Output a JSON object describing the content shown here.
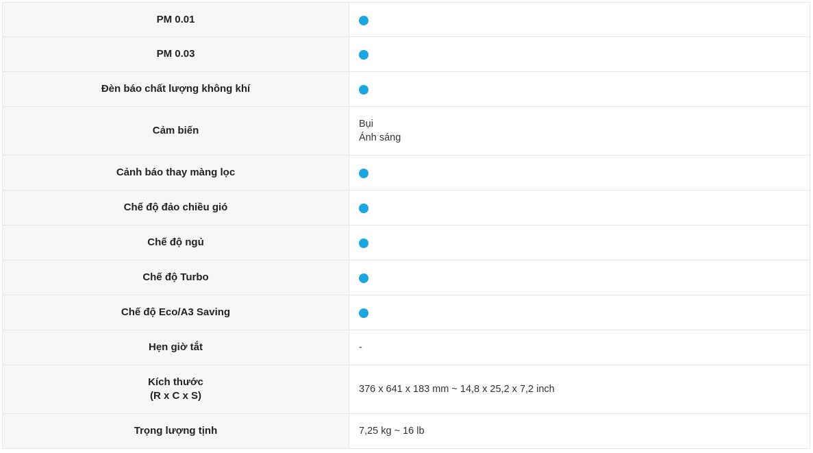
{
  "rows": [
    {
      "label": [
        "PM 0.01"
      ],
      "type": "dot"
    },
    {
      "label": [
        "PM 0.03"
      ],
      "type": "dot"
    },
    {
      "label": [
        "Đèn báo chất lượng không khí"
      ],
      "type": "dot"
    },
    {
      "label": [
        "Cảm biến"
      ],
      "type": "text",
      "value": [
        "Bụi",
        "Ánh sáng"
      ]
    },
    {
      "label": [
        "Cảnh báo thay màng lọc"
      ],
      "type": "dot"
    },
    {
      "label": [
        "Chế độ đảo chiều gió"
      ],
      "type": "dot"
    },
    {
      "label": [
        "Chế độ ngủ"
      ],
      "type": "dot"
    },
    {
      "label": [
        "Chế độ Turbo"
      ],
      "type": "dot"
    },
    {
      "label": [
        "Chế độ Eco/A3 Saving"
      ],
      "type": "dot"
    },
    {
      "label": [
        "Hẹn giờ tắt"
      ],
      "type": "text",
      "value": [
        "-"
      ]
    },
    {
      "label": [
        "Kích thước",
        "(R x C x S)"
      ],
      "type": "text",
      "value": [
        "376 x 641 x 183 mm ~ 14,8 x 25,2 x 7,2 inch"
      ]
    },
    {
      "label": [
        "Trọng lượng tịnh"
      ],
      "type": "text",
      "value": [
        "7,25 kg ~ 16 lb"
      ]
    }
  ],
  "colors": {
    "dot": "#1aa7e0",
    "label_bg": "#f7f7f7",
    "border": "#e6e6e6"
  },
  "icons": {
    "supported": "filled-circle-icon"
  }
}
